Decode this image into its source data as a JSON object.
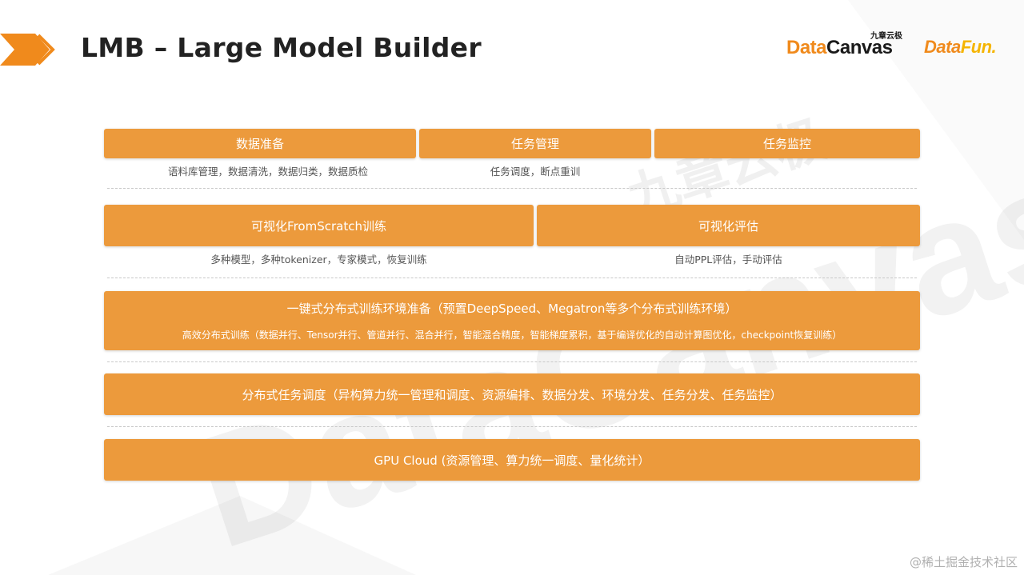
{
  "header": {
    "title": "LMB – Large Model Builder",
    "logos": {
      "datacanvas_part1": "Data",
      "datacanvas_part2": "Canvas",
      "datacanvas_cn": "九章云极",
      "datafun_part1": "Data",
      "datafun_part2": "Fun."
    }
  },
  "watermark": {
    "cn": "九章云极",
    "en": "DataCanvas"
  },
  "diagram": {
    "row1": {
      "data_prep": {
        "label": "数据准备",
        "note": "语料库管理，数据清洗，数据归类，数据质检"
      },
      "task_mgmt": {
        "label": "任务管理",
        "note": "任务调度，断点重训"
      },
      "task_monitor": {
        "label": "任务监控"
      }
    },
    "row2": {
      "visual_train": {
        "label": "可视化FromScratch训练",
        "note": "多种模型，多种tokenizer，专家模式，恢复训练"
      },
      "visual_eval": {
        "label": "可视化评估",
        "note": "自动PPL评估，手动评估"
      }
    },
    "row3": {
      "label": "一键式分布式训练环境准备（预置DeepSpeed、Megatron等多个分布式训练环境）",
      "sub": "高效分布式训练（数据并行、Tensor并行、管道并行、混合并行，智能混合精度，智能梯度累积，基于编译优化的自动计算图优化，checkpoint恢复训练）"
    },
    "row4": {
      "label": "分布式任务调度（异构算力统一管理和调度、资源编排、数据分发、环境分发、任务分发、任务监控）"
    },
    "row5": {
      "label": "GPU Cloud (资源管理、算力统一调度、量化统计）"
    }
  },
  "footer": {
    "text": "@稀土掘金技术社区"
  },
  "colors": {
    "accent": "#ec9a3c",
    "brand_orange": "#f08a1c",
    "brand_yellow": "#f5b400"
  }
}
